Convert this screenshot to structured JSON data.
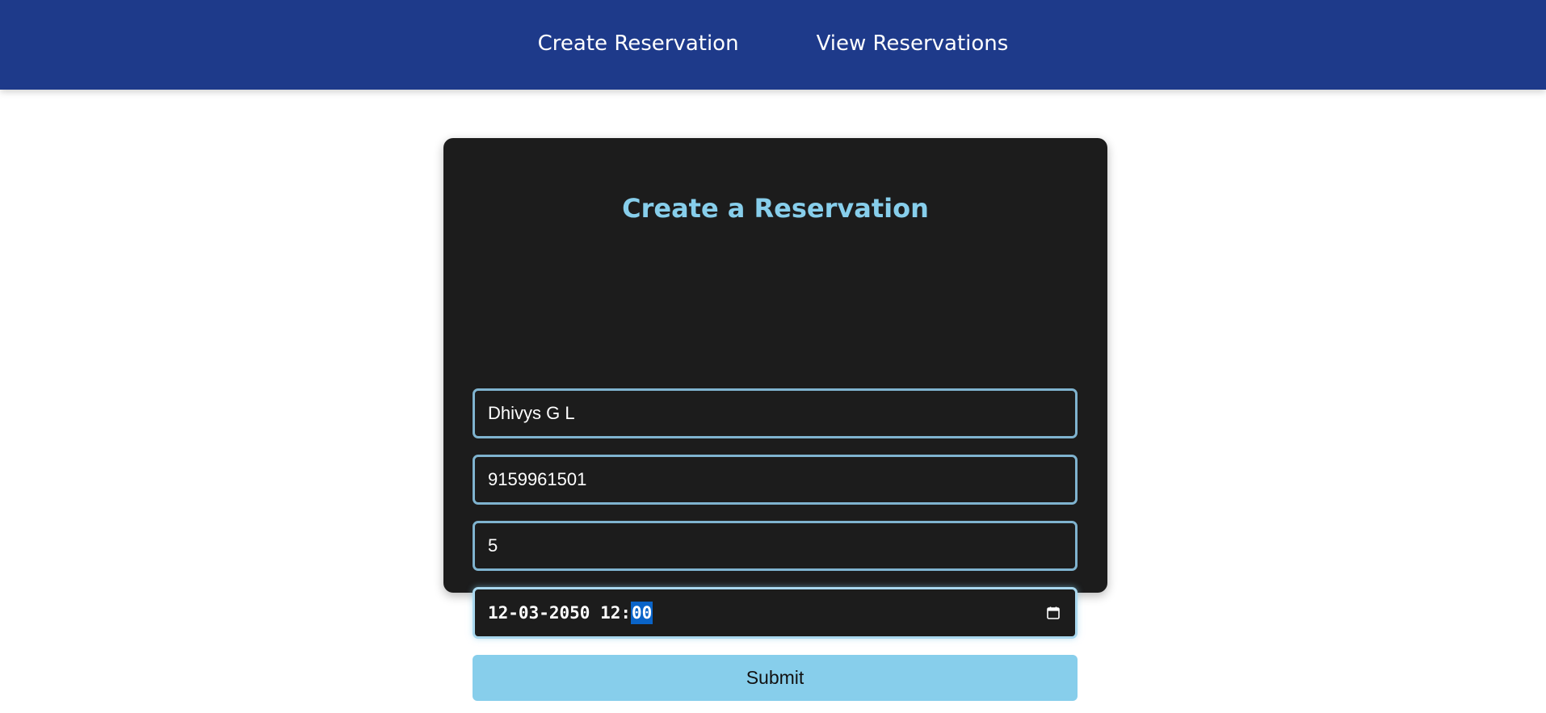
{
  "nav": {
    "create_label": "Create Reservation",
    "view_label": "View Reservations"
  },
  "form": {
    "title": "Create a Reservation",
    "name_value": "Dhivys G L",
    "phone_value": "9159961501",
    "guests_value": "5",
    "datetime_prefix": "12-03-2050 12:",
    "datetime_selected": "00",
    "submit_label": "Submit"
  },
  "colors": {
    "navbar": "#1e3a8a",
    "card": "#1c1c1c",
    "accent": "#87ceeb",
    "selection": "#0a64c8"
  },
  "icons": {
    "datetime_picker": "calendar-icon"
  }
}
